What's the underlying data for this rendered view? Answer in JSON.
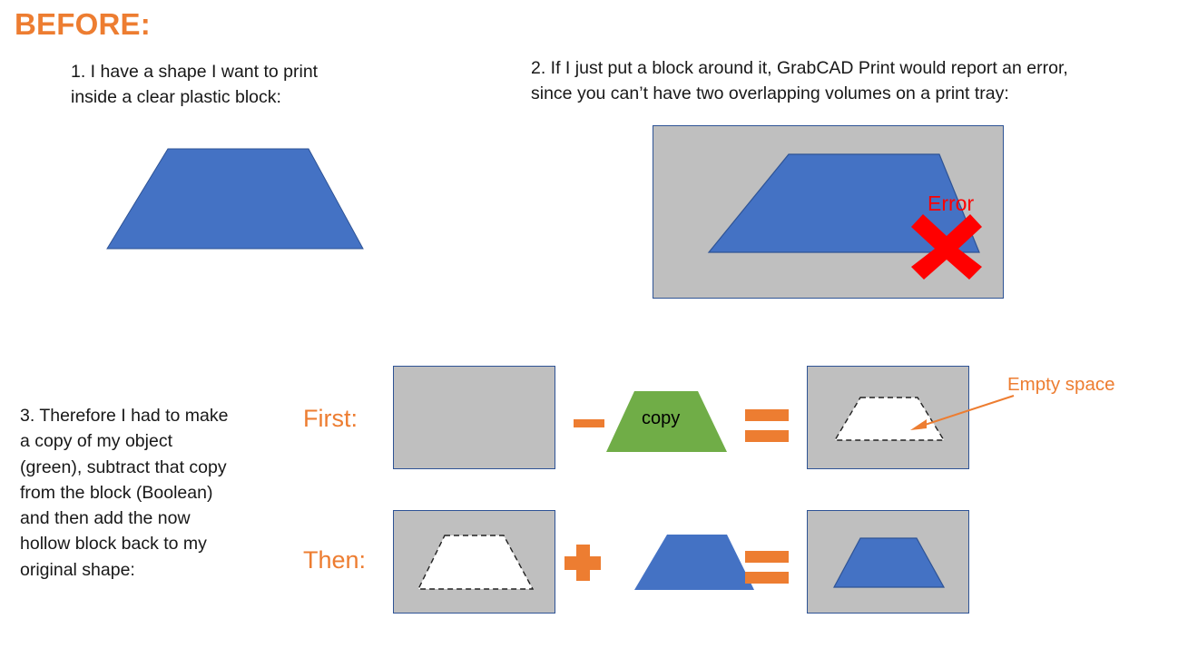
{
  "title": "BEFORE:",
  "colors": {
    "accent_orange": "#ED7D31",
    "shape_blue": "#4472C4",
    "shape_blue_outline": "#2E5395",
    "copy_green": "#70AD47",
    "block_gray": "#BFBFBF",
    "block_outline": "#2E5395",
    "error_red": "#FF0000",
    "empty_white": "#FFFFFF",
    "text_black": "#181818"
  },
  "steps": {
    "step1": "1. I have a shape I want to print\ninside a clear plastic block:",
    "step2": "2. If I just put a block around it, GrabCAD Print would report an error,\nsince you can’t have two overlapping volumes on a print tray:",
    "step3": "3. Therefore I had to make\na copy of my object\n(green), subtract that copy\nfrom the block (Boolean)\nand then add the now\nhollow block back to my\noriginal shape:"
  },
  "annotations": {
    "error": "Error",
    "empty_space": "Empty space",
    "copy": "copy"
  },
  "operations": {
    "first_label": "First:",
    "then_label": "Then:",
    "minus_symbol": "−",
    "plus_symbol": "+",
    "equals_symbol": "="
  },
  "diagram_data": {
    "type": "diagram",
    "shapes": [
      {
        "name": "hero-trapezoid",
        "kind": "trapezoid",
        "fill": "#4472C4"
      },
      {
        "name": "panel2-block",
        "kind": "rectangle",
        "fill": "#BFBFBF"
      },
      {
        "name": "panel2-trapezoid",
        "kind": "trapezoid",
        "fill": "#4472C4"
      },
      {
        "name": "error-x",
        "kind": "cross",
        "fill": "#FF0000"
      },
      {
        "name": "first-operand-block",
        "kind": "rectangle",
        "fill": "#BFBFBF"
      },
      {
        "name": "copy-trapezoid",
        "kind": "trapezoid",
        "fill": "#70AD47"
      },
      {
        "name": "first-result-cavity",
        "kind": "trapezoid-dashed",
        "fill": "#FFFFFF"
      },
      {
        "name": "then-operand-cavity",
        "kind": "trapezoid-dashed",
        "fill": "#FFFFFF"
      },
      {
        "name": "then-blue-trapezoid",
        "kind": "trapezoid",
        "fill": "#4472C4"
      },
      {
        "name": "then-result-trapezoid",
        "kind": "trapezoid",
        "fill": "#4472C4"
      }
    ]
  }
}
